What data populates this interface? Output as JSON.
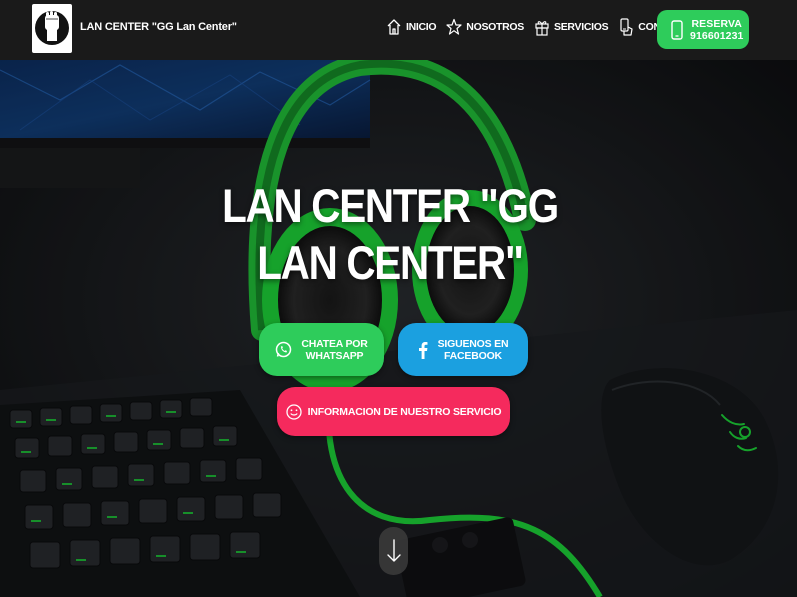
{
  "header": {
    "brand": "LAN CENTER \"GG Lan Center\"",
    "nav": [
      {
        "label": "INICIO",
        "icon": "home-icon"
      },
      {
        "label": "NOSOTROS",
        "icon": "star-icon"
      },
      {
        "label": "SERVICIOS",
        "icon": "gift-icon"
      },
      {
        "label": "CONTACTO",
        "icon": "phone-hand-icon"
      }
    ],
    "reserve": {
      "line1": "RESERVA",
      "line2": "916601231",
      "icon": "mobile-icon"
    }
  },
  "hero": {
    "title": "LAN CENTER \"GG LAN CENTER\"",
    "buttons": {
      "whatsapp": {
        "line1": "CHATEA POR",
        "line2": "WHATSAPP",
        "icon": "whatsapp-icon"
      },
      "facebook": {
        "line1": "SIGUENOS EN",
        "line2": "FACEBOOK",
        "icon": "facebook-icon"
      },
      "info": {
        "label": "INFORMACION DE NUESTRO SERVICIO",
        "icon": "smiley-icon"
      }
    },
    "scroll_icon": "arrow-down-icon"
  },
  "colors": {
    "header_bg": "#1a1a1a",
    "reserve_green": "#2ecc5b",
    "whatsapp_green": "#2ecc5b",
    "facebook_blue": "#1ba0e0",
    "info_pink": "#f52a5d",
    "razer_green": "#1ed93a"
  }
}
